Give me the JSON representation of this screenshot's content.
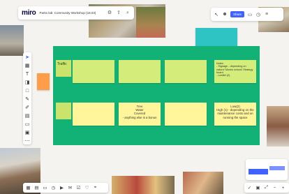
{
  "header": {
    "logo": "miro",
    "board_title": "Parks lab: Community Workshop (18.03)"
  },
  "right_toolbar": {
    "share_label": "Share"
  },
  "frame": {
    "title": "",
    "color": "#12b176",
    "rows": [
      {
        "label": "Traffic",
        "notes": [
          "",
          "",
          "",
          ""
        ]
      },
      {
        "label": "",
        "notes": [
          "",
          "Tree\nWater\nCovered\n- anything else is a bonus",
          "",
          "Low(2)\nHigh (1) - depending on the maintenance costs and on running the space"
        ]
      }
    ],
    "top_right_note": "Notes\n- Signage - depending on nature/ Monks school/ Strategy board\n- Leaflet (2)"
  },
  "below_frame_label": "",
  "colors": {
    "accent": "#4262ff",
    "sticky_green": "#d4ec7a",
    "sticky_yellow": "#fff59a",
    "orange_note": "#ff9d48",
    "teal_note": "#2ec4c4"
  },
  "left_tools": [
    "cursor-icon",
    "frame-icon",
    "text-icon",
    "sticky-note-icon",
    "shape-icon",
    "pen-icon",
    "comment-icon",
    "table-icon",
    "card-icon",
    "upload-icon",
    "more-icon"
  ],
  "bottom_tools": [
    "grid-icon",
    "layers-icon",
    "board-icon",
    "timer-icon",
    "video-icon",
    "chat-icon",
    "vote-icon",
    "like-icon",
    "location-icon"
  ]
}
